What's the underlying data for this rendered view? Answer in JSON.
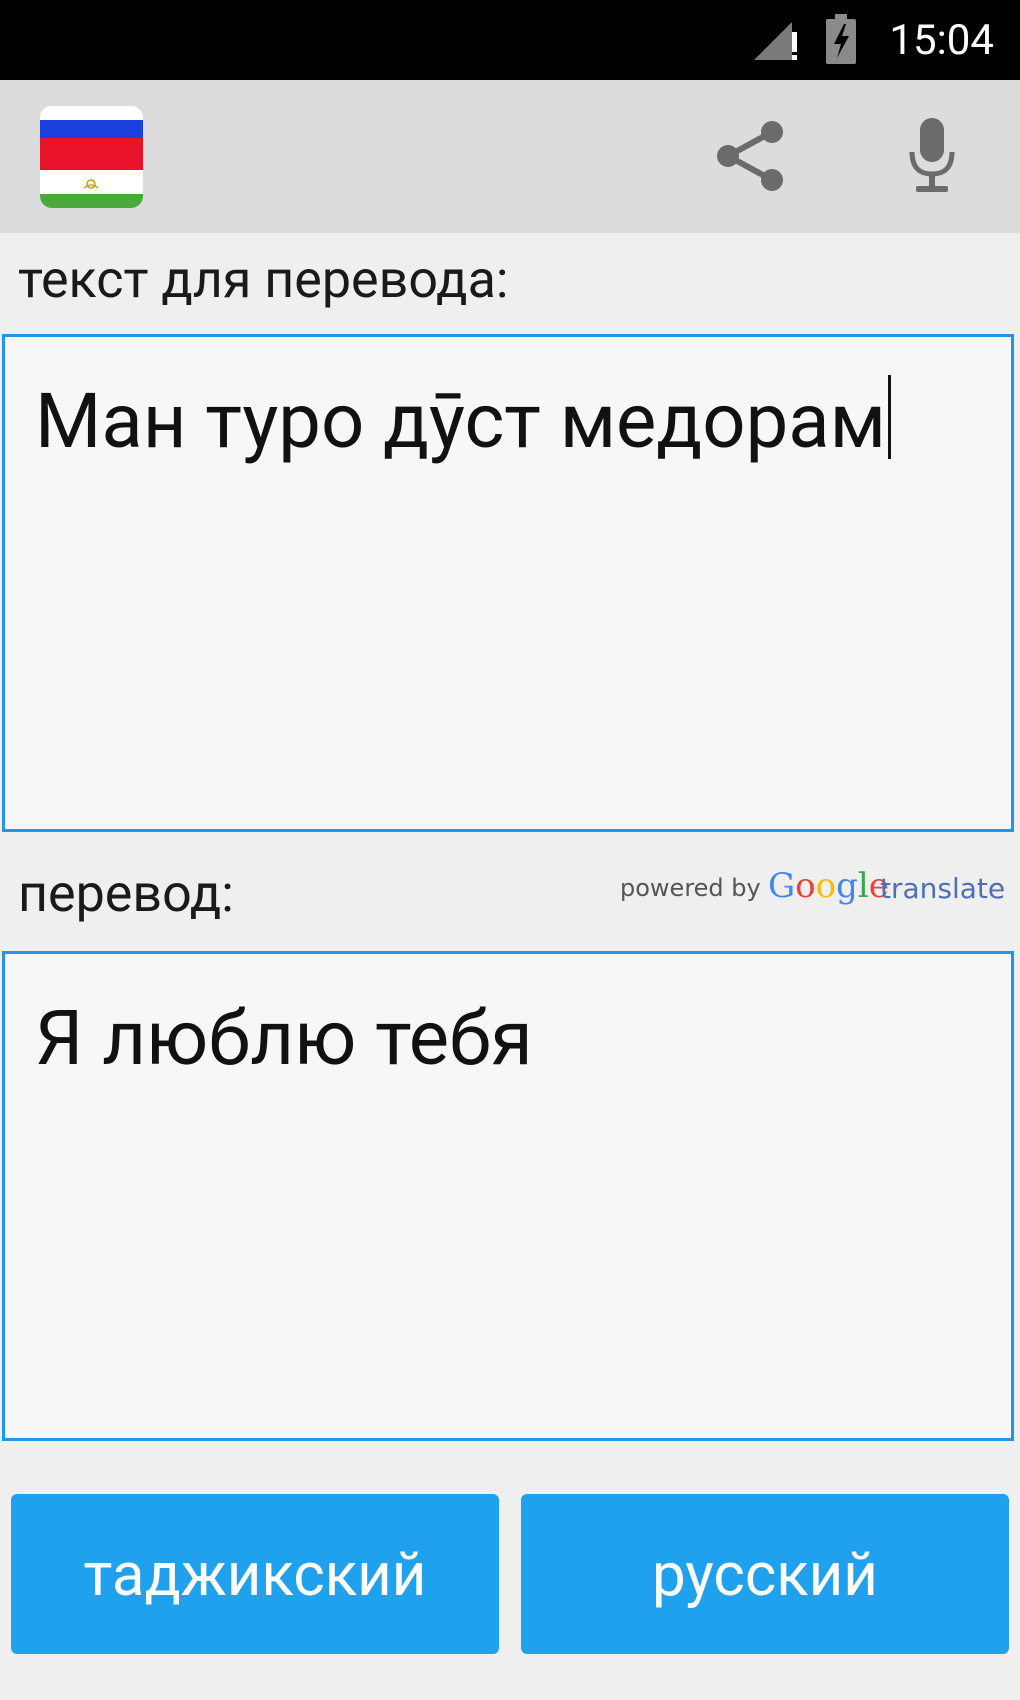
{
  "status_bar": {
    "time": "15:04",
    "icons": [
      "signal-alert-icon",
      "battery-charging-icon"
    ]
  },
  "app_bar": {
    "flag": "russia-tajikistan-flag-icon",
    "actions": [
      "share-icon",
      "mic-icon"
    ]
  },
  "source": {
    "label": "текст для перевода:",
    "text": "Ман туро дӯст медорам"
  },
  "target": {
    "label": "перевод:",
    "text": "Я люблю тебя",
    "powered_by": "powered by",
    "google": "Google",
    "translate": "translate"
  },
  "buttons": {
    "source_lang": "таджикский",
    "target_lang": "русский"
  },
  "colors": {
    "accent": "#2196e8",
    "button": "#20a1ed",
    "app_bar": "#dcdcdc"
  }
}
